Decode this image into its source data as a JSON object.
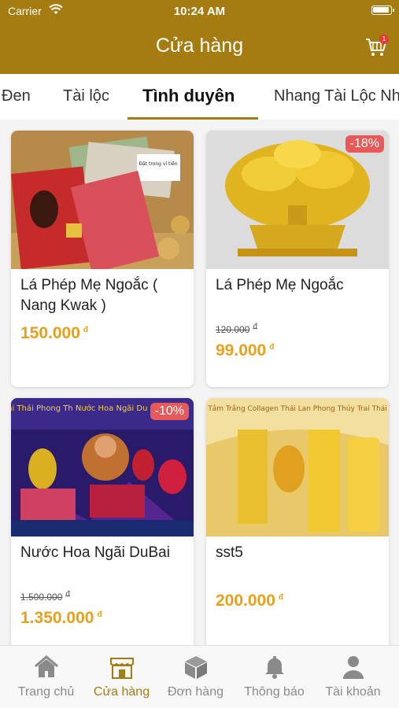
{
  "status_bar": {
    "carrier": "Carrier",
    "time": "10:24 AM"
  },
  "header": {
    "title": "Cửa hàng",
    "cart_badge": "1"
  },
  "tabs": [
    {
      "label": "Đen"
    },
    {
      "label": "Tài lộc"
    },
    {
      "label": "Tình duyên",
      "active": true
    },
    {
      "label": "Nhang Tài Lộc Nh"
    }
  ],
  "products": [
    {
      "name": "Lá Phép Mẹ Ngoắc ( Nang Kwak )",
      "price": "150.000",
      "currency": "đ"
    },
    {
      "name": "Lá Phép Mẹ Ngoắc",
      "old_price": "120.000",
      "price": "99.000",
      "currency": "đ",
      "discount": "-18%"
    },
    {
      "name": "Nước Hoa Ngãi DuBai",
      "old_price": "1.500.000",
      "price": "1.350.000",
      "currency": "đ",
      "discount": "-10%",
      "banner_text": "Trai Thái Phong Th Nước Hoa Ngãi Du"
    },
    {
      "name": "sst5",
      "price": "200.000",
      "currency": "đ",
      "banner_text": "Tắm Trắng Collagen Thái Lan Phong Thủy Trai Thái"
    }
  ],
  "image_text": {
    "wallet_note": "Đặt trong ví tiền"
  },
  "bottom_nav": [
    {
      "label": "Trang chủ",
      "icon": "home-icon"
    },
    {
      "label": "Cửa hàng",
      "icon": "store-icon",
      "active": true
    },
    {
      "label": "Đơn hàng",
      "icon": "package-icon"
    },
    {
      "label": "Thông báo",
      "icon": "bell-icon"
    },
    {
      "label": "Tài khoản",
      "icon": "user-icon"
    }
  ],
  "colors": {
    "brand": "#a57c12",
    "price": "#e8a01a",
    "discount": "#e85a5a",
    "inactive": "#8a8a8a"
  }
}
